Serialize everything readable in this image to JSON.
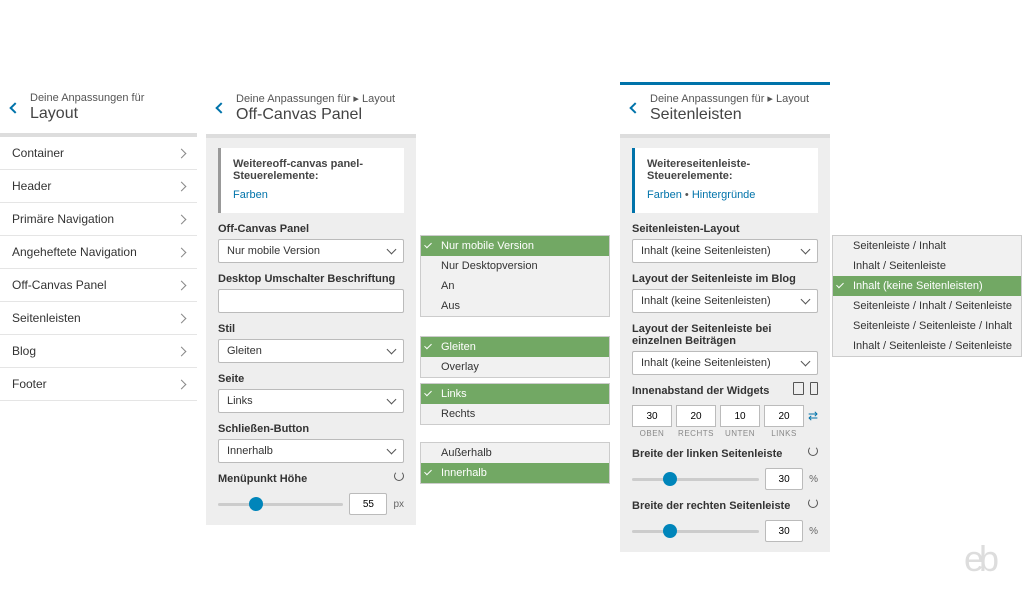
{
  "panel1": {
    "crumb": "Deine Anpassungen für",
    "title": "Layout",
    "items": [
      "Container",
      "Header",
      "Primäre Navigation",
      "Angeheftete Navigation",
      "Off-Canvas Panel",
      "Seitenleisten",
      "Blog",
      "Footer"
    ]
  },
  "panel2": {
    "crumb": "Deine Anpassungen für ▸ Layout",
    "title": "Off-Canvas Panel",
    "notice_title": "Weitereoff-canvas panel-Steuerelemente:",
    "notice_link": "Farben",
    "fields": {
      "offcanvas_label": "Off-Canvas Panel",
      "offcanvas_value": "Nur mobile Version",
      "offcanvas_options": [
        "Nur mobile Version",
        "Nur Desktopversion",
        "An",
        "Aus"
      ],
      "desktop_label": "Desktop Umschalter Beschriftung",
      "desktop_value": "",
      "stil_label": "Stil",
      "stil_value": "Gleiten",
      "stil_options": [
        "Gleiten",
        "Overlay"
      ],
      "seite_label": "Seite",
      "seite_value": "Links",
      "seite_options": [
        "Links",
        "Rechts"
      ],
      "close_label": "Schließen-Button",
      "close_value": "Innerhalb",
      "close_options": [
        "Außerhalb",
        "Innerhalb"
      ],
      "menu_label": "Menüpunkt Höhe",
      "menu_value": "55",
      "menu_unit": "px"
    }
  },
  "panel3": {
    "crumb": "Deine Anpassungen für ▸ Layout",
    "title": "Seitenleisten",
    "notice_title": "Weitereseitenleiste-Steuerelemente:",
    "notice_link1": "Farben",
    "notice_sep": " • ",
    "notice_link2": "Hintergründe",
    "fields": {
      "layout_label": "Seitenleisten-Layout",
      "layout_value": "Inhalt (keine Seitenleisten)",
      "layout_options": [
        "Seitenleiste / Inhalt",
        "Inhalt / Seitenleiste",
        "Inhalt (keine Seitenleisten)",
        "Seitenleiste / Inhalt / Seitenleiste",
        "Seitenleiste / Seitenleiste / Inhalt",
        "Inhalt / Seitenleiste / Seitenleiste"
      ],
      "blog_label": "Layout der Seitenleiste im Blog",
      "blog_value": "Inhalt (keine Seitenleisten)",
      "single_label": "Layout der Seitenleiste bei einzelnen Beiträgen",
      "single_value": "Inhalt (keine Seitenleisten)",
      "padding_label": "Innenabstand der Widgets",
      "padding": {
        "top": "30",
        "right": "20",
        "bottom": "10",
        "left": "20"
      },
      "padding_labels": {
        "top": "OBEN",
        "right": "RECHTS",
        "bottom": "UNTEN",
        "left": "LINKS"
      },
      "left_width_label": "Breite der linken Seitenleiste",
      "left_width_value": "30",
      "right_width_label": "Breite der rechten Seitenleiste",
      "right_width_value": "30",
      "unit_pct": "%"
    }
  }
}
